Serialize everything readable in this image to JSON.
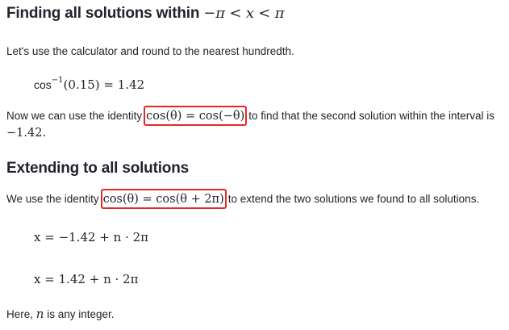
{
  "heading1": {
    "text": "Finding all solutions within",
    "math": "−π < x < π"
  },
  "intro": "Let's use the calculator and round to the nearest hundredth.",
  "equation1": {
    "lhs": "cos",
    "sup": "−1",
    "arg": "(0.15) = 1.42"
  },
  "para2": {
    "before": "Now we can use the identity",
    "identity": "cos(θ) = cos(−θ)",
    "after": "to find that the second solution within the interval is",
    "value": "−1.42."
  },
  "heading2": "Extending to all solutions",
  "para3": {
    "before": "We use the identity",
    "identity": "cos(θ) = cos(θ + 2π)",
    "after": "to extend the two solutions we found to all solutions."
  },
  "equation2": "x = −1.42 + n · 2π",
  "equation3": "x = 1.42 + n · 2π",
  "closing": {
    "before": "Here,",
    "var": "n",
    "after": "is any integer."
  },
  "colors": {
    "highlight_border": "#e8262a",
    "text": "#21242c"
  }
}
